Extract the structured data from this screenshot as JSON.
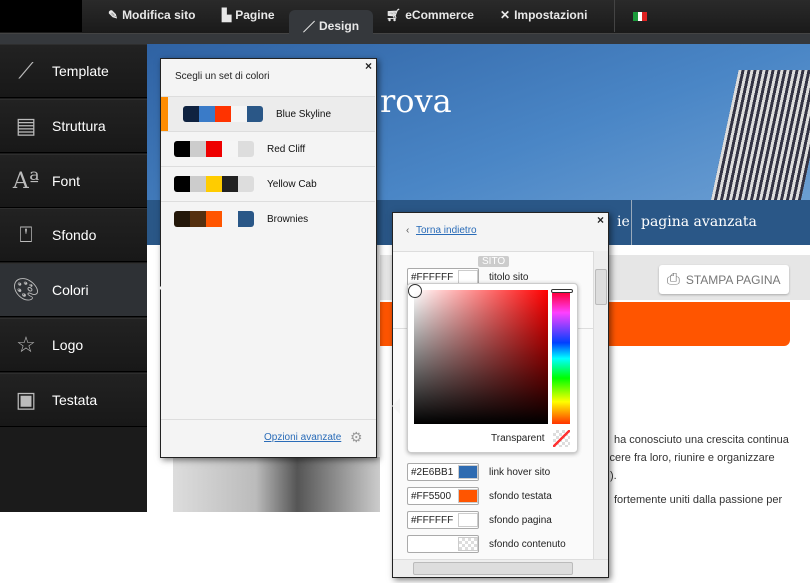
{
  "topbar": {
    "tabs": [
      {
        "label": "Modifica sito",
        "icon": "pencil-icon"
      },
      {
        "label": "Pagine",
        "icon": "pages-icon"
      },
      {
        "label": "Design",
        "icon": "brush-icon",
        "active": true
      },
      {
        "label": "eCommerce",
        "icon": "cart-icon"
      },
      {
        "label": "Impostazioni",
        "icon": "tools-icon"
      }
    ],
    "language": "it"
  },
  "sidebar": {
    "items": [
      {
        "label": "Template",
        "icon": "brush-icon"
      },
      {
        "label": "Struttura",
        "icon": "layout-icon"
      },
      {
        "label": "Font",
        "icon": "font-icon"
      },
      {
        "label": "Sfondo",
        "icon": "background-icon"
      },
      {
        "label": "Colori",
        "icon": "palette-icon",
        "active": true
      },
      {
        "label": "Logo",
        "icon": "star-icon"
      },
      {
        "label": "Testata",
        "icon": "header-icon"
      }
    ]
  },
  "preview": {
    "title_fragment": "rova",
    "nav_fragment": "ie",
    "nav_item": "pagina avanzata",
    "print_button": "STAMPA PAGINA",
    "text_lines": [
      "ha conosciuto una crescita continua",
      "scere fra loro, riunire e organizzare",
      ").",
      "fortemente uniti dalla passione per"
    ]
  },
  "color_sets": {
    "title": "Scegli un set di colori",
    "close": "×",
    "advanced_link": "Opzioni avanzate",
    "sets": [
      {
        "name": "Blue Skyline",
        "colors": [
          "#0f2240",
          "#3a7bc8",
          "#ff3300",
          "#f5f5f5",
          "#2a5787"
        ],
        "selected": true
      },
      {
        "name": "Red Cliff",
        "colors": [
          "#000000",
          "#cccccc",
          "#ee0000",
          "#f5f5f5",
          "#dddddd"
        ]
      },
      {
        "name": "Yellow Cab",
        "colors": [
          "#000000",
          "#cccccc",
          "#ffcc00",
          "#222222",
          "#dddddd"
        ]
      },
      {
        "name": "Brownies",
        "colors": [
          "#231709",
          "#55300f",
          "#ff5500",
          "#f5f5f5",
          "#2a5787"
        ]
      }
    ]
  },
  "advanced": {
    "back_link": "Torna indietro",
    "close": "×",
    "section": "SITO",
    "rows": [
      {
        "hex": "#FFFFFF",
        "color": "#ffffff",
        "label": "titolo sito"
      },
      {
        "hex": "#2E6BB1",
        "color": "#2e6bb1",
        "label": "link hover sito"
      },
      {
        "hex": "#FF5500",
        "color": "#ff5500",
        "label": "sfondo testata"
      },
      {
        "hex": "#FFFFFF",
        "color": "#ffffff",
        "label": "sfondo pagina"
      },
      {
        "hex": "",
        "color": "transparent",
        "label": "sfondo contenuto"
      }
    ]
  },
  "picker": {
    "transparent_label": "Transparent",
    "hue": "#ff0000"
  }
}
